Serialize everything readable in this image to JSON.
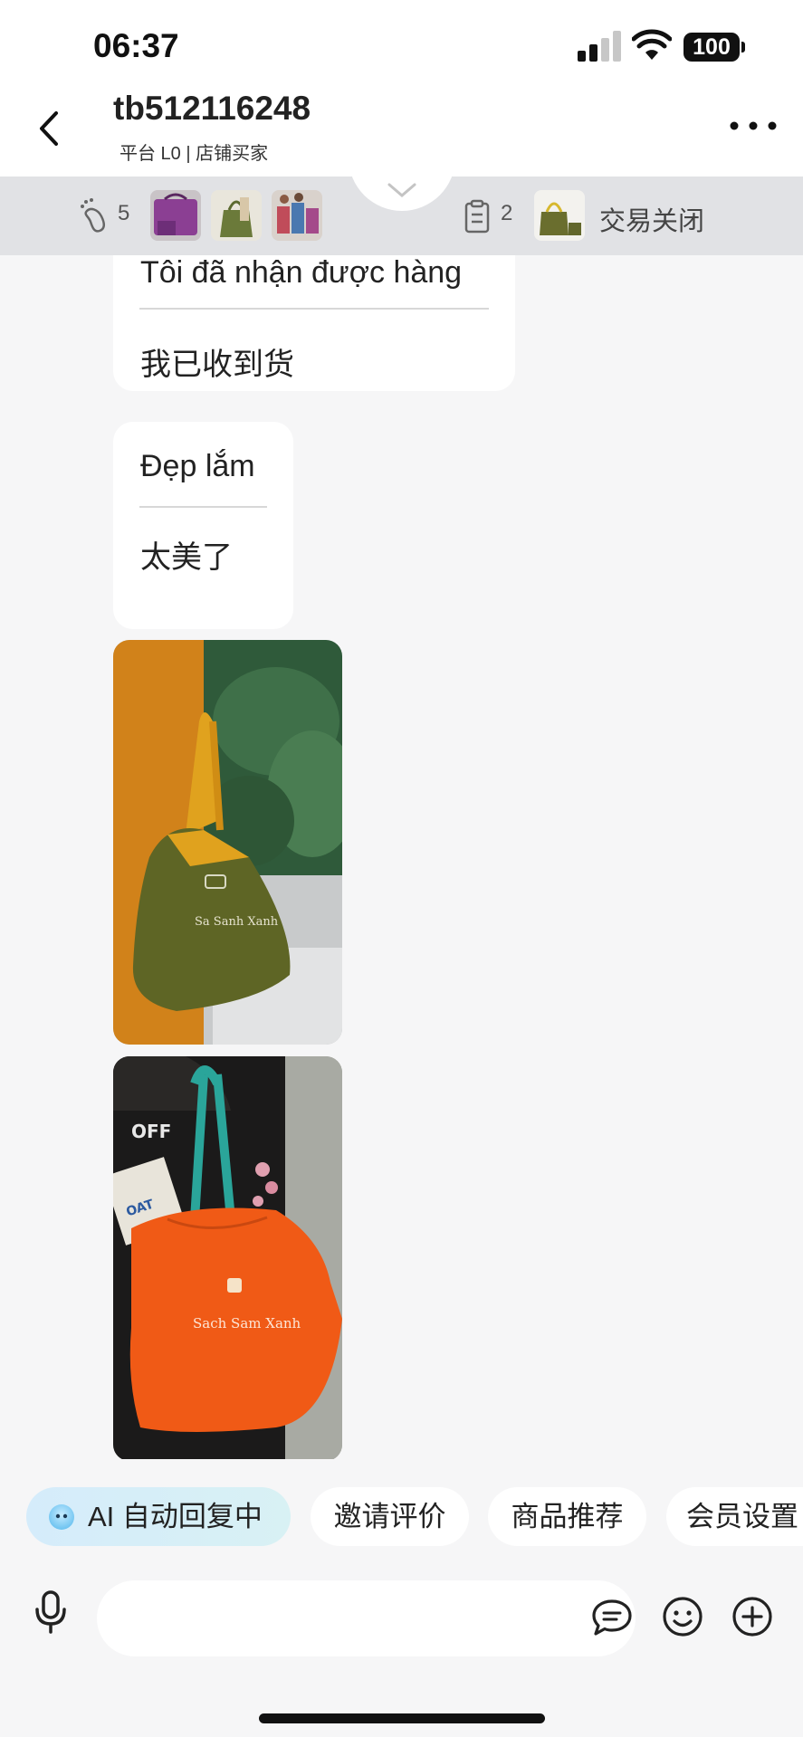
{
  "status_bar": {
    "time": "06:37",
    "battery": "100",
    "signal_icon": "signal-bars-icon",
    "wifi_icon": "wifi-icon"
  },
  "header": {
    "title": "tb512116248",
    "subtitle": "平台 L0 | 店铺买家",
    "back_icon": "chevron-left-icon",
    "more_icon": "ellipsis-icon"
  },
  "info_bar": {
    "footprint_count": "5",
    "order_count": "2",
    "deal_status": "交易关闭"
  },
  "messages": [
    {
      "original": "Tôi đã nhận được hàng",
      "translation": "我已收到货"
    },
    {
      "original": "Đẹp lắm",
      "translation": "太美了"
    }
  ],
  "quick_actions": {
    "ai_label": "AI 自动回复中",
    "invite_review": "邀请评价",
    "product_recommend": "商品推荐",
    "member_settings": "会员设置"
  },
  "input": {
    "placeholder": ""
  },
  "colors": {
    "background": "#f6f6f7",
    "bubble": "#ffffff",
    "info_bar": "#e1e2e5",
    "ai_chip": "#d5ecfb"
  }
}
